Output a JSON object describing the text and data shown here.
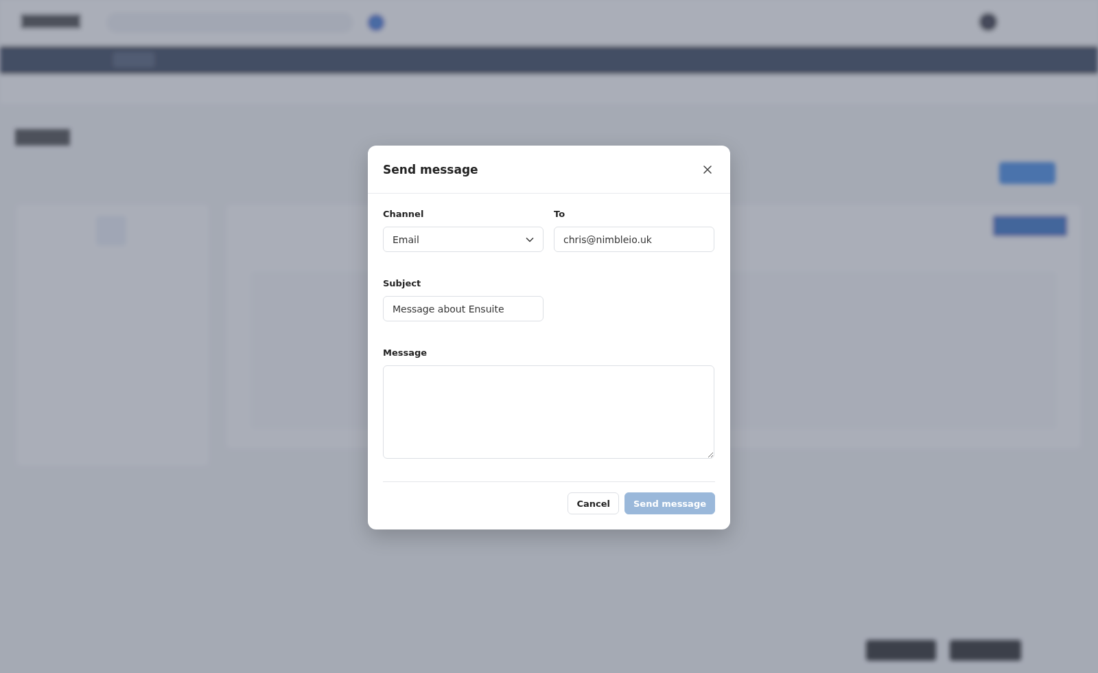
{
  "dialog": {
    "title": "Send message",
    "fields": [
      {
        "kind": "select",
        "label": "Channel",
        "value": "Email"
      },
      {
        "kind": "text",
        "label": "To",
        "value": "chris@nimbleio.uk"
      },
      {
        "kind": "text",
        "label": "Subject",
        "value": "Message about Ensuite"
      },
      {
        "kind": "textarea",
        "label": "Message"
      }
    ],
    "buttons": [
      {
        "label": "Cancel",
        "kind": "secondary",
        "disabled": false
      },
      {
        "label": "Send message",
        "kind": "primary",
        "disabled": true
      }
    ]
  }
}
